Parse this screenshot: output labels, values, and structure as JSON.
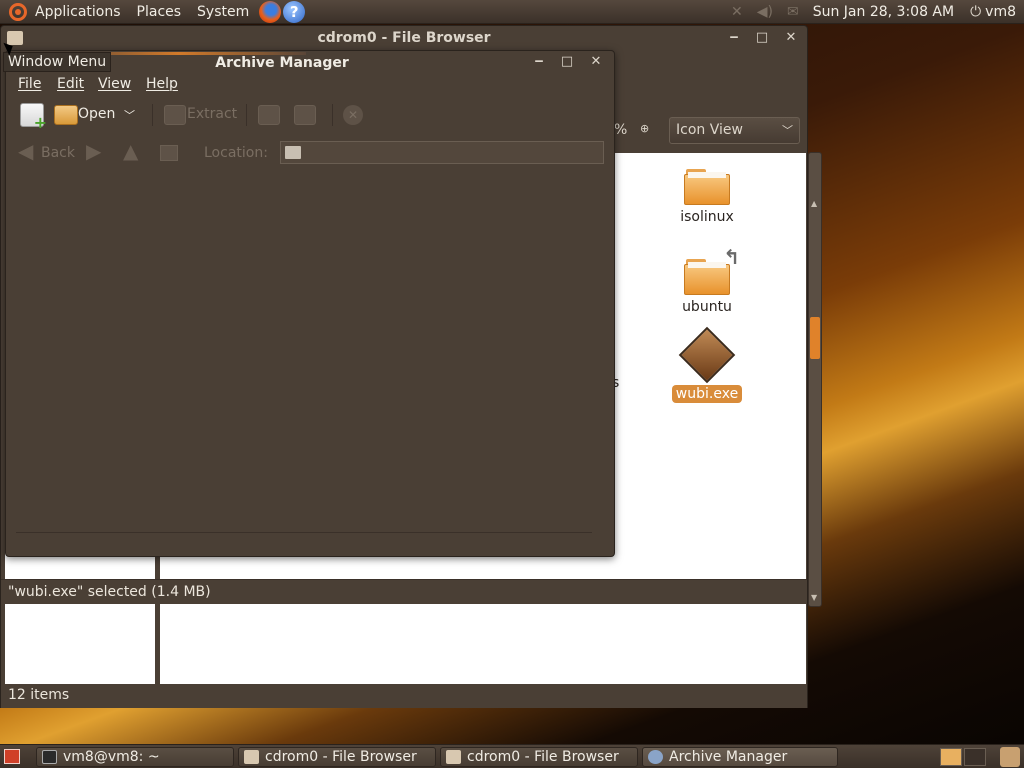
{
  "top_panel": {
    "applications": "Applications",
    "places": "Places",
    "system": "System",
    "clock": "Sun Jan 28,  3:08 AM",
    "user": "vm8"
  },
  "file_browser": {
    "title": "cdrom0 - File Browser",
    "zoom_percent": "%",
    "view_mode": "Icon View",
    "items": [
      {
        "name": "isolinux",
        "type": "folder"
      },
      {
        "name": "ubuntu",
        "type": "folder-link"
      },
      {
        "name": "wubi.exe",
        "type": "exe",
        "selected": true
      }
    ],
    "partial_label": "s",
    "status_selected": "\"wubi.exe\" selected (1.4 MB)",
    "status_items": "12 items"
  },
  "archive_manager": {
    "title": "Archive Manager",
    "menu": [
      "File",
      "Edit",
      "View",
      "Help"
    ],
    "toolbar": {
      "open_label": "Open",
      "extract_label": "Extract"
    },
    "nav": {
      "back_label": "Back",
      "location_label": "Location:",
      "location_value": ""
    }
  },
  "tooltip": "Window Menu",
  "taskbar": [
    {
      "label": "vm8@vm8: ~"
    },
    {
      "label": "cdrom0 - File Browser"
    },
    {
      "label": "cdrom0 - File Browser"
    },
    {
      "label": "Archive Manager"
    }
  ],
  "colors": {
    "accent": "#d98c3a",
    "panel": "#3b3129",
    "window": "#4a3f35"
  }
}
